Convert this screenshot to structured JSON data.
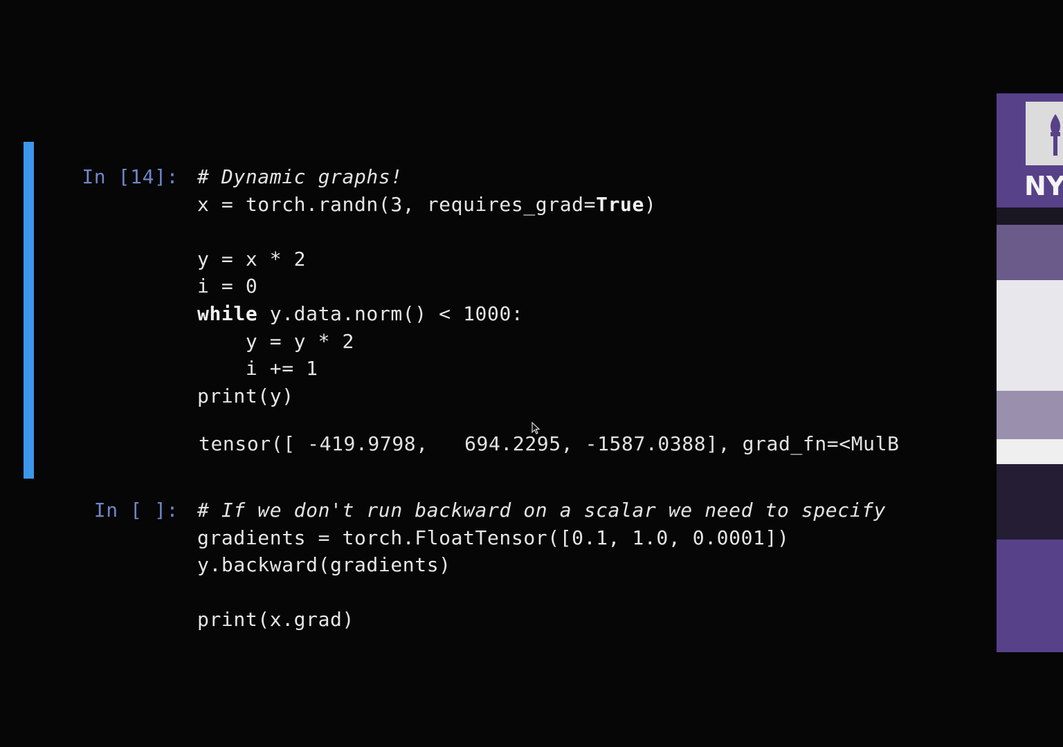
{
  "cells": [
    {
      "prompt": "In [14]:",
      "lines": {
        "l1": "# Dynamic graphs!",
        "l2a": "x = torch.randn(3, requires_grad=",
        "l2b": "True",
        "l2c": ")",
        "l3": "y = x * 2",
        "l4": "i = 0",
        "l5a": "while",
        "l5b": " y.data.norm() < 1000:",
        "l6": "    y = y * 2",
        "l7": "    i += 1",
        "l8": "print(y)"
      },
      "output": "tensor([ -419.9798,   694.2295, -1587.0388], grad_fn=<MulB"
    },
    {
      "prompt": "In [ ]:",
      "lines": {
        "l1": "# If we don't run backward on a scalar we need to specify",
        "l2": "gradients = torch.FloatTensor([0.1, 1.0, 0.0001])",
        "l3": "y.backward(gradients)",
        "l4": "print(x.grad)"
      }
    }
  ],
  "side_panel": {
    "logo_text": "NY",
    "icon": "torch-icon",
    "accent": "#574189"
  },
  "colors": {
    "background": "#060606",
    "selection_bar": "#3d97ea",
    "prompt": "#6f86c8"
  }
}
